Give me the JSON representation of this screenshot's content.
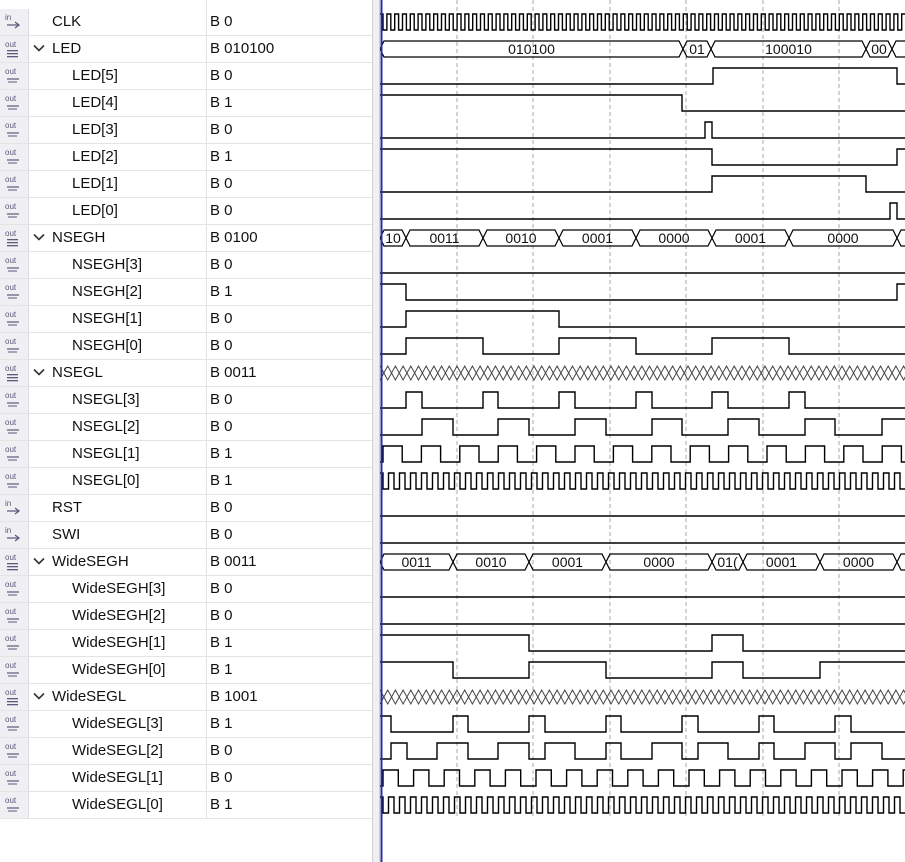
{
  "colors": {
    "wave": "#000000",
    "cursor": "#2b2ba6",
    "grid": "#aaaaaa",
    "icon_in": "#5a5a7a",
    "icon_out": "#5a5a7a"
  },
  "signals": [
    {
      "name": "CLK",
      "value": "B 0",
      "kind": "in",
      "indent": 0,
      "expand": false
    },
    {
      "name": "LED",
      "value": "B 010100",
      "kind": "bus",
      "indent": 0,
      "expand": true
    },
    {
      "name": "LED[5]",
      "value": "B 0",
      "kind": "out",
      "indent": 1,
      "expand": false
    },
    {
      "name": "LED[4]",
      "value": "B 1",
      "kind": "out",
      "indent": 1,
      "expand": false
    },
    {
      "name": "LED[3]",
      "value": "B 0",
      "kind": "out",
      "indent": 1,
      "expand": false
    },
    {
      "name": "LED[2]",
      "value": "B 1",
      "kind": "out",
      "indent": 1,
      "expand": false
    },
    {
      "name": "LED[1]",
      "value": "B 0",
      "kind": "out",
      "indent": 1,
      "expand": false
    },
    {
      "name": "LED[0]",
      "value": "B 0",
      "kind": "out",
      "indent": 1,
      "expand": false
    },
    {
      "name": "NSEGH",
      "value": "B 0100",
      "kind": "bus",
      "indent": 0,
      "expand": true
    },
    {
      "name": "NSEGH[3]",
      "value": "B 0",
      "kind": "out",
      "indent": 1,
      "expand": false
    },
    {
      "name": "NSEGH[2]",
      "value": "B 1",
      "kind": "out",
      "indent": 1,
      "expand": false
    },
    {
      "name": "NSEGH[1]",
      "value": "B 0",
      "kind": "out",
      "indent": 1,
      "expand": false
    },
    {
      "name": "NSEGH[0]",
      "value": "B 0",
      "kind": "out",
      "indent": 1,
      "expand": false
    },
    {
      "name": "NSEGL",
      "value": "B 0011",
      "kind": "bus",
      "indent": 0,
      "expand": true
    },
    {
      "name": "NSEGL[3]",
      "value": "B 0",
      "kind": "out",
      "indent": 1,
      "expand": false
    },
    {
      "name": "NSEGL[2]",
      "value": "B 0",
      "kind": "out",
      "indent": 1,
      "expand": false
    },
    {
      "name": "NSEGL[1]",
      "value": "B 1",
      "kind": "out",
      "indent": 1,
      "expand": false
    },
    {
      "name": "NSEGL[0]",
      "value": "B 1",
      "kind": "out",
      "indent": 1,
      "expand": false
    },
    {
      "name": "RST",
      "value": "B 0",
      "kind": "in",
      "indent": 0,
      "expand": false
    },
    {
      "name": "SWI",
      "value": "B 0",
      "kind": "in",
      "indent": 0,
      "expand": false
    },
    {
      "name": "WideSEGH",
      "value": "B 0011",
      "kind": "bus",
      "indent": 0,
      "expand": true
    },
    {
      "name": "WideSEGH[3]",
      "value": "B 0",
      "kind": "out",
      "indent": 1,
      "expand": false
    },
    {
      "name": "WideSEGH[2]",
      "value": "B 0",
      "kind": "out",
      "indent": 1,
      "expand": false
    },
    {
      "name": "WideSEGH[1]",
      "value": "B 1",
      "kind": "out",
      "indent": 1,
      "expand": false
    },
    {
      "name": "WideSEGH[0]",
      "value": "B 1",
      "kind": "out",
      "indent": 1,
      "expand": false
    },
    {
      "name": "WideSEGL",
      "value": "B 1001",
      "kind": "bus",
      "indent": 0,
      "expand": true
    },
    {
      "name": "WideSEGL[3]",
      "value": "B 1",
      "kind": "out",
      "indent": 1,
      "expand": false
    },
    {
      "name": "WideSEGL[2]",
      "value": "B 0",
      "kind": "out",
      "indent": 1,
      "expand": false
    },
    {
      "name": "WideSEGL[1]",
      "value": "B 0",
      "kind": "out",
      "indent": 1,
      "expand": false
    },
    {
      "name": "WideSEGL[0]",
      "value": "B 1",
      "kind": "out",
      "indent": 1,
      "expand": false
    }
  ],
  "bus_labels": {
    "LED": [
      "010100",
      "01",
      "100010",
      "00"
    ],
    "NSEGH": [
      "10",
      "0011",
      "0010",
      "0001",
      "0000",
      "0001",
      "0000"
    ],
    "WideSEGH": [
      "0011",
      "0010",
      "0001",
      "0000",
      "01(",
      "0001",
      "0000"
    ]
  }
}
